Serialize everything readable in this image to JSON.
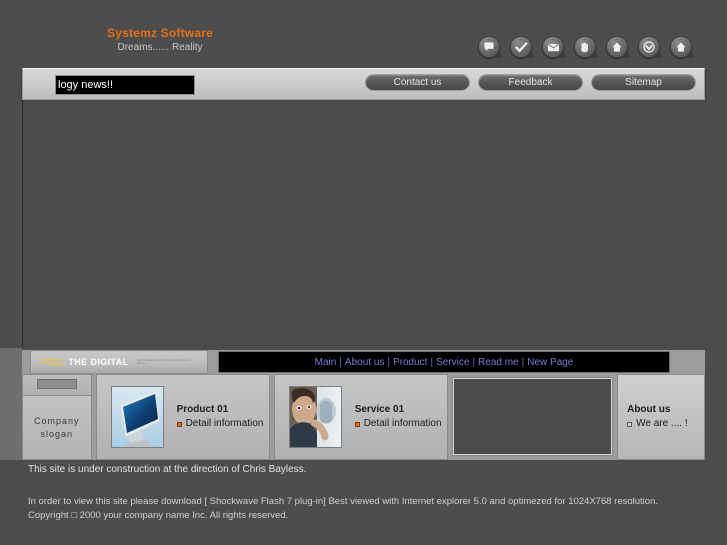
{
  "header": {
    "logo_title": "Systemz Software",
    "logo_subtitle": "Dreams...... Reality",
    "icons": [
      {
        "name": "speech-bubble-icon",
        "label": "Comments"
      },
      {
        "name": "check-icon",
        "label": "Confirm"
      },
      {
        "name": "envelope-icon",
        "label": "Email"
      },
      {
        "name": "hand-icon",
        "label": "Welcome"
      },
      {
        "name": "home-icon",
        "label": "Home"
      },
      {
        "name": "chevron-down-icon",
        "label": "Download"
      },
      {
        "name": "home-icon",
        "label": "Home"
      }
    ]
  },
  "navbar": {
    "marquee_text": "logy news!!",
    "buttons": [
      {
        "label": "Contact us"
      },
      {
        "label": "Feedback"
      },
      {
        "label": "Sitemap"
      }
    ]
  },
  "midstrip": {
    "feel_accent": "FEEL",
    "feel_rest": " THE DIGITAL",
    "fine_print": "FeelTheDigital RepaiFuzuPoiof.oF.weDeFSD aF DRMOo",
    "links": [
      "Main",
      "About us",
      "Product",
      "Service",
      "Read me",
      "New Page"
    ],
    "separator": "|"
  },
  "cards": {
    "slogan": "Company slogan",
    "product": {
      "title": "Product 01",
      "link": "Detail information",
      "thumb": "monitor-image"
    },
    "service": {
      "title": "Service 01",
      "link": "Detail information",
      "thumb": "phone-call-photo"
    },
    "about": {
      "title": "About us",
      "line": "We are .... !"
    }
  },
  "footer": {
    "note": "This site is under construction at the direction of Chris Bayless.",
    "legal_line1": "In order to view this site please download [ Shockwave Flash 7 plug-in] Best viewed with Internet explorer 5.0 and optimezed for 1024X768 resolution.",
    "legal_line2": "Copyright □ 2000 your company name Inc. All rights reserved."
  },
  "colors": {
    "brand_orange": "#e8701a",
    "accent_yellow": "#e7c54a",
    "link_blue": "#7b7bd8",
    "page_bg": "#4d4d4d"
  }
}
